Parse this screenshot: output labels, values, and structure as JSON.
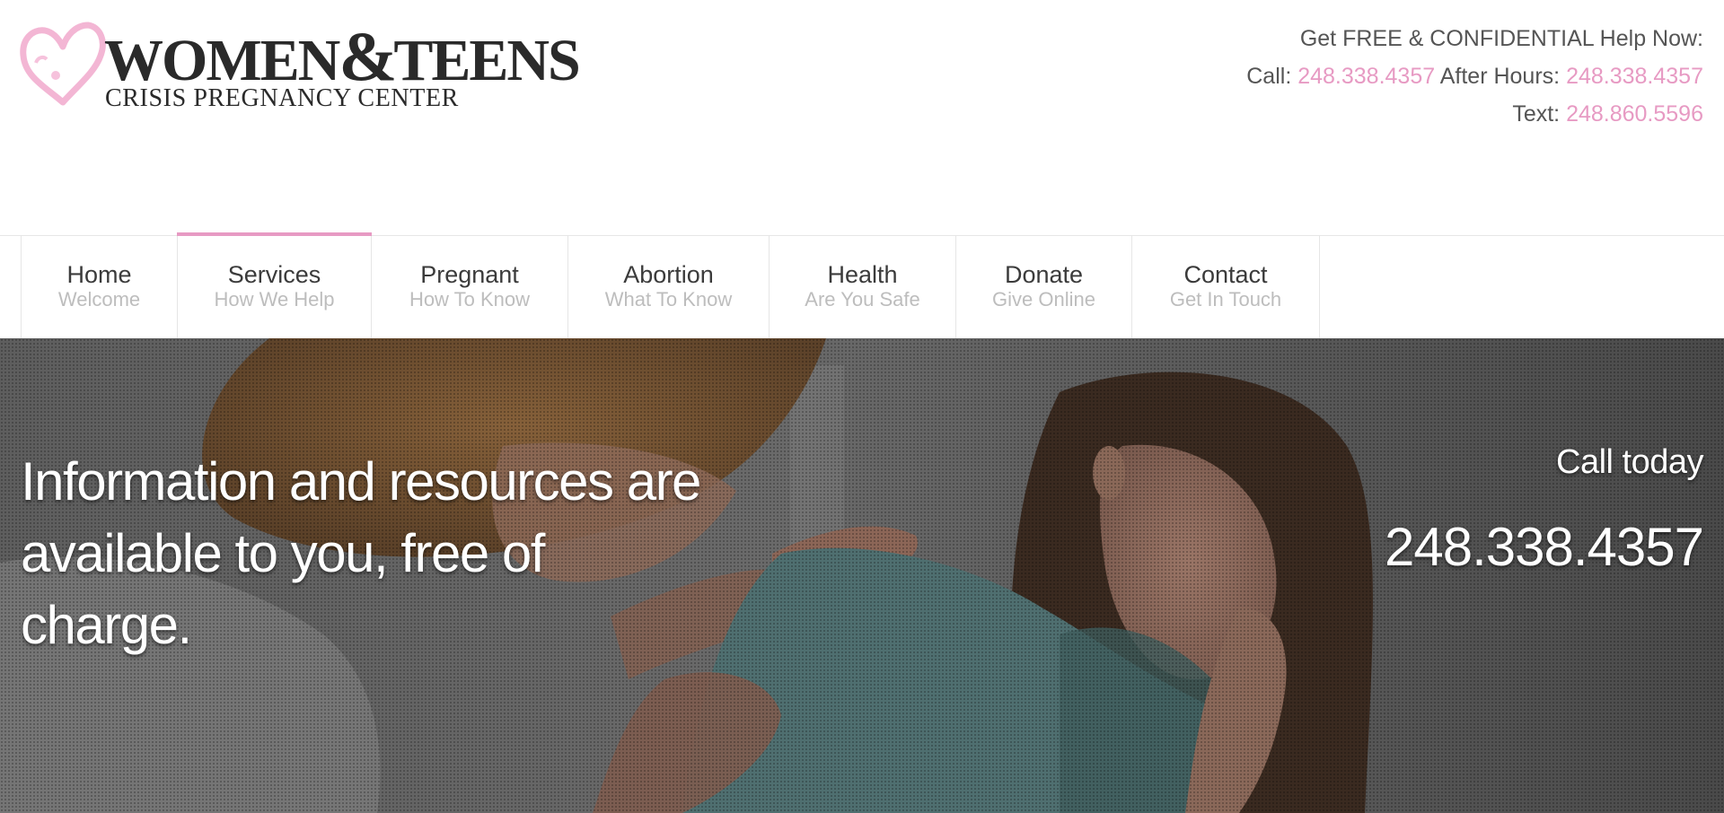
{
  "logo": {
    "title_a": "Women",
    "title_amp": "&",
    "title_b": "Teens",
    "subtitle": "Crisis Pregnancy Center"
  },
  "contact": {
    "headline": "Get FREE & CONFIDENTIAL Help Now:",
    "call_label": "Call:",
    "call_number": "248.338.4357",
    "after_hours_label": "After Hours:",
    "after_hours_number": "248.338.4357",
    "text_label": "Text:",
    "text_number": "248.860.5596"
  },
  "nav": {
    "items": [
      {
        "title": "Home",
        "sub": "Welcome"
      },
      {
        "title": "Services",
        "sub": "How We Help"
      },
      {
        "title": "Pregnant",
        "sub": "How To Know"
      },
      {
        "title": "Abortion",
        "sub": "What To Know"
      },
      {
        "title": "Health",
        "sub": "Are You Safe"
      },
      {
        "title": "Donate",
        "sub": "Give Online"
      },
      {
        "title": "Contact",
        "sub": "Get In Touch"
      }
    ],
    "active_index": 1
  },
  "hero": {
    "heading_line1": "Information and resources are",
    "heading_line2": "available to you, free of",
    "heading_line3": "charge.",
    "call_label": "Call today",
    "call_number": "248.338.4357"
  },
  "colors": {
    "accent_pink": "#e79ac3",
    "nav_border": "#e6e6e6",
    "text_dark": "#3b3b3b"
  }
}
